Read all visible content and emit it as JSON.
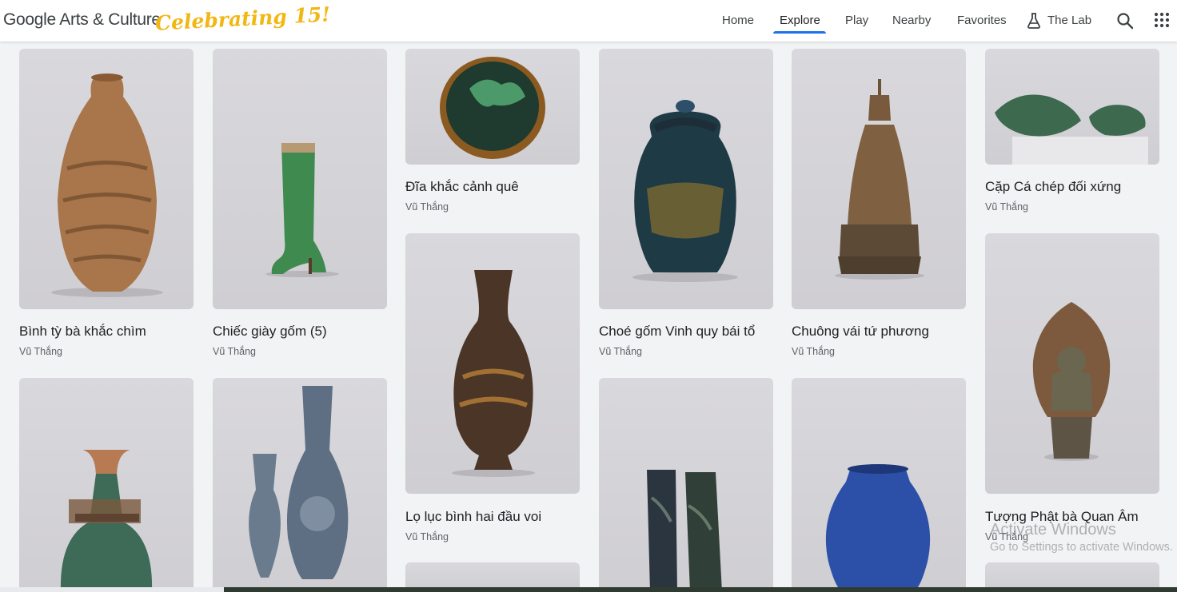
{
  "header": {
    "logo": "Google Arts & Culture",
    "celebrating": "Celebrating 15!",
    "nav": {
      "home": "Home",
      "explore": "Explore",
      "play": "Play",
      "nearby": "Nearby",
      "favorites": "Favorites",
      "lab": "The Lab"
    },
    "icons": {
      "lab": "flask-icon",
      "search": "search-icon",
      "apps": "apps-grid-icon"
    },
    "accent": "#1a73e8"
  },
  "items": [
    {
      "title": "Bình tỳ bà khắc chìm",
      "author": "Vũ Thắng"
    },
    {
      "title": "Chiếc giày gốm (5)",
      "author": "Vũ Thắng"
    },
    {
      "title": "Đĩa khắc cảnh quê",
      "author": "Vũ Thắng"
    },
    {
      "title": "Choé gốm Vinh quy bái tổ",
      "author": "Vũ Thắng"
    },
    {
      "title": "Chuông vái tứ phương",
      "author": "Vũ Thắng"
    },
    {
      "title": "Cặp Cá chép đối xứng",
      "author": "Vũ Thắng"
    },
    {
      "title": "Lọ lục bình hai đầu voi",
      "author": "Vũ Thắng"
    },
    {
      "title": "Tượng Phật bà Quan Âm",
      "author": "Vũ Thắng"
    }
  ],
  "watermark": {
    "line1": "Activate Windows",
    "line2": "Go to Settings to activate Windows."
  }
}
